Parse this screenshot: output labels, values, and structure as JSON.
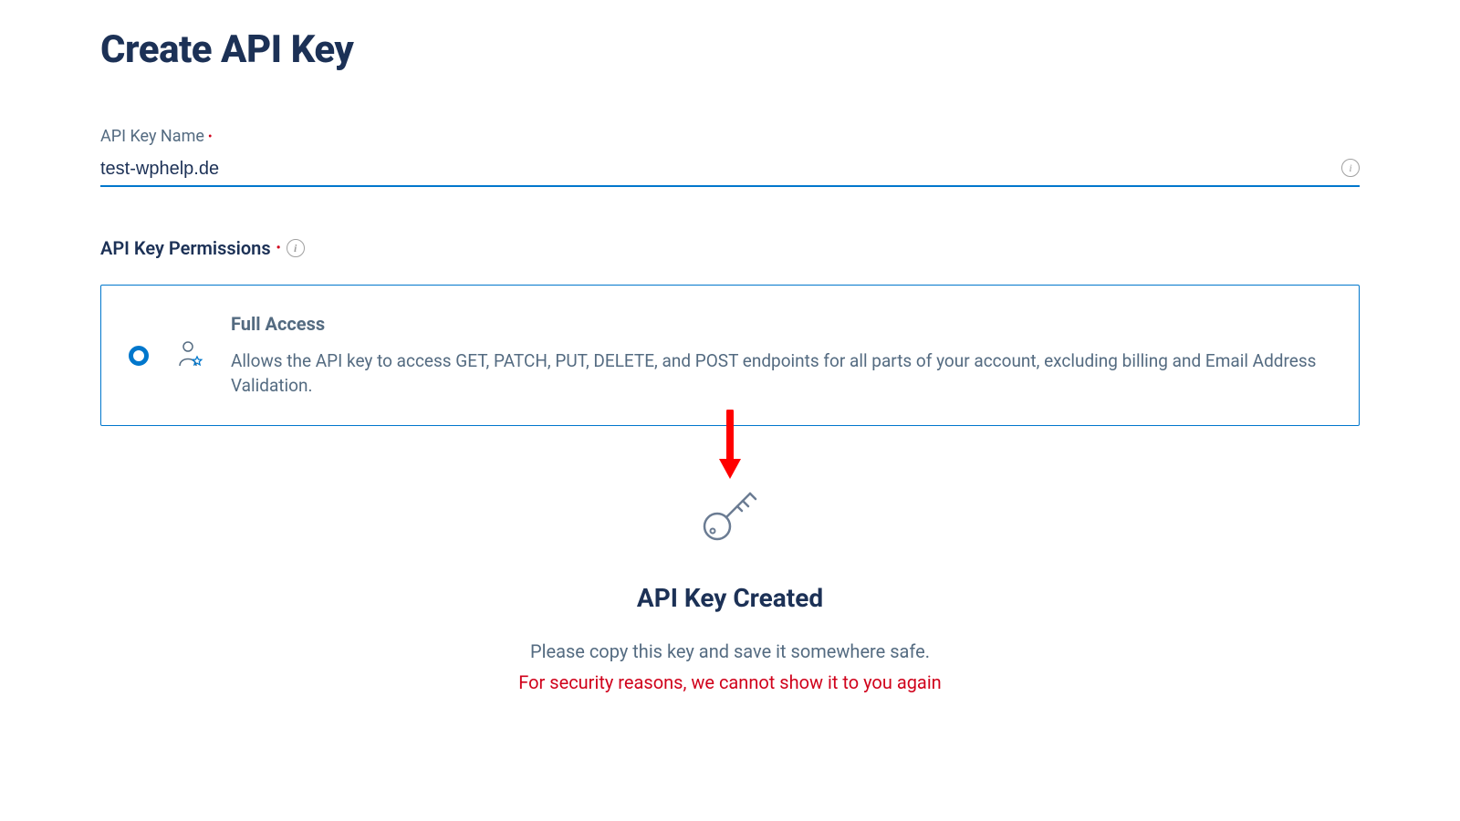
{
  "page": {
    "title": "Create API Key"
  },
  "name_field": {
    "label": "API Key Name",
    "value": "test-wphelp.de"
  },
  "permissions": {
    "header": "API Key Permissions",
    "option": {
      "title": "Full Access",
      "description": "Allows the API key to access GET, PATCH, PUT, DELETE, and POST endpoints for all parts of your account, excluding billing and Email Address Validation."
    }
  },
  "created": {
    "title": "API Key Created",
    "instruction": "Please copy this key and save it somewhere safe.",
    "warning": "For security reasons, we cannot show it to you again"
  },
  "colors": {
    "primary_text": "#1c3156",
    "secondary_text": "#546b81",
    "accent_blue": "#0077cc",
    "danger_red": "#d0021b"
  }
}
